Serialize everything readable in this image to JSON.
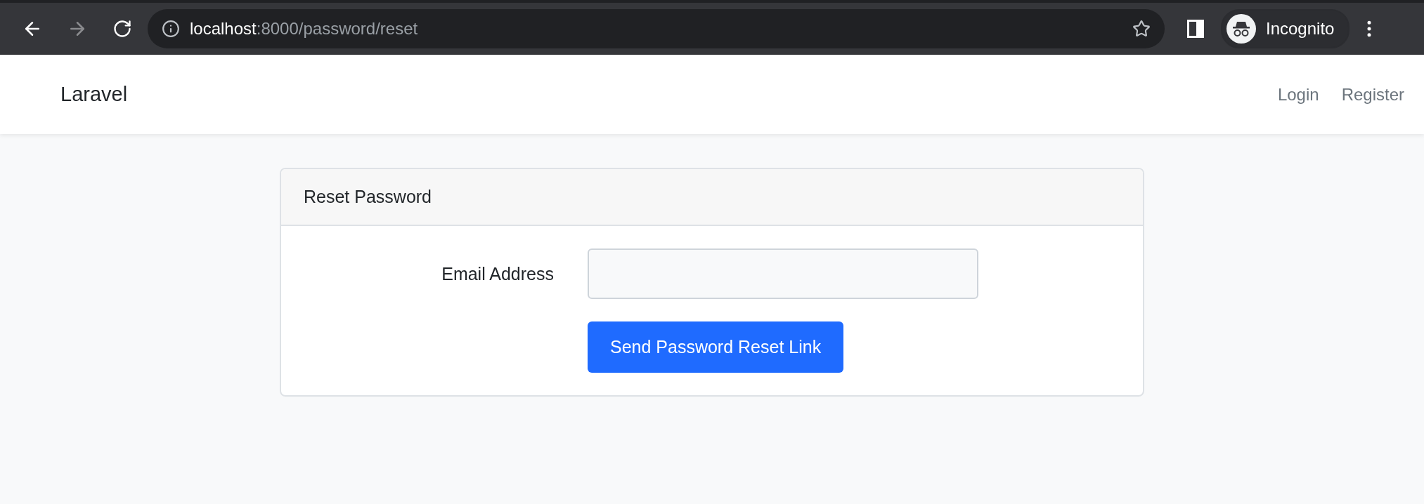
{
  "browser": {
    "url": {
      "host": "localhost",
      "path": ":8000/password/reset"
    },
    "profile": "Incognito"
  },
  "navbar": {
    "brand": "Laravel",
    "links": [
      "Login",
      "Register"
    ]
  },
  "card": {
    "title": "Reset Password",
    "fields": [
      {
        "label": "Email Address"
      }
    ],
    "submit": "Send Password Reset Link"
  }
}
